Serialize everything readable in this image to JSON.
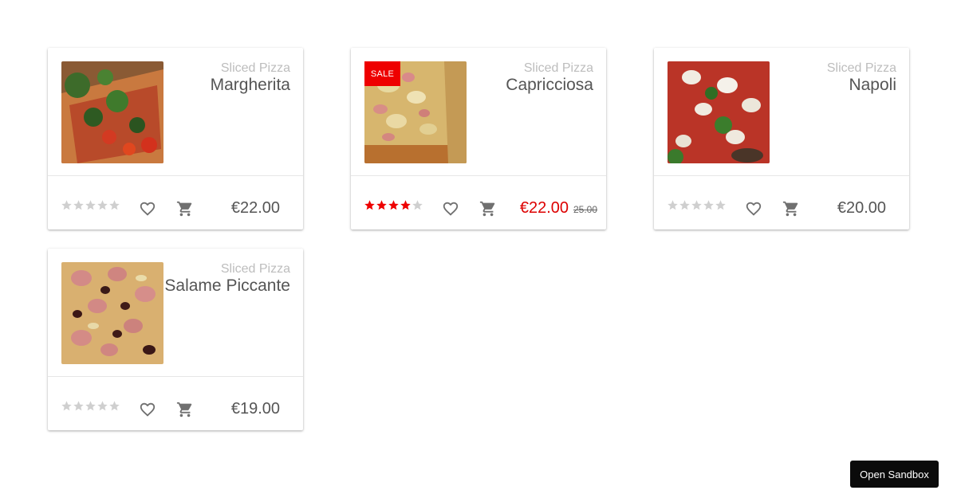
{
  "products": [
    {
      "category": "Sliced Pizza",
      "name": "Margherita",
      "price": "€22.00",
      "rating": 0,
      "sale": false
    },
    {
      "category": "Sliced Pizza",
      "name": "Capricciosa",
      "price": "€22.00",
      "old_price": "25.00",
      "rating": 4,
      "sale": true,
      "sale_label": "SALE"
    },
    {
      "category": "Sliced Pizza",
      "name": "Napoli",
      "price": "€20.00",
      "rating": 0,
      "sale": false
    },
    {
      "category": "Sliced Pizza",
      "name": "Salame Piccante",
      "price": "€19.00",
      "rating": 0,
      "sale": false
    }
  ],
  "rating_max": 5,
  "sandbox_label": "Open Sandbox",
  "colors": {
    "sale": "#ee0000",
    "sale_price": "#dd0000",
    "star_active": "#ee0000",
    "star_inactive": "#cfcfcf",
    "icon": "#707070"
  },
  "icons": {
    "wishlist": "heart-outline-icon",
    "cart": "shopping-cart-icon",
    "rating": "star-icon"
  }
}
